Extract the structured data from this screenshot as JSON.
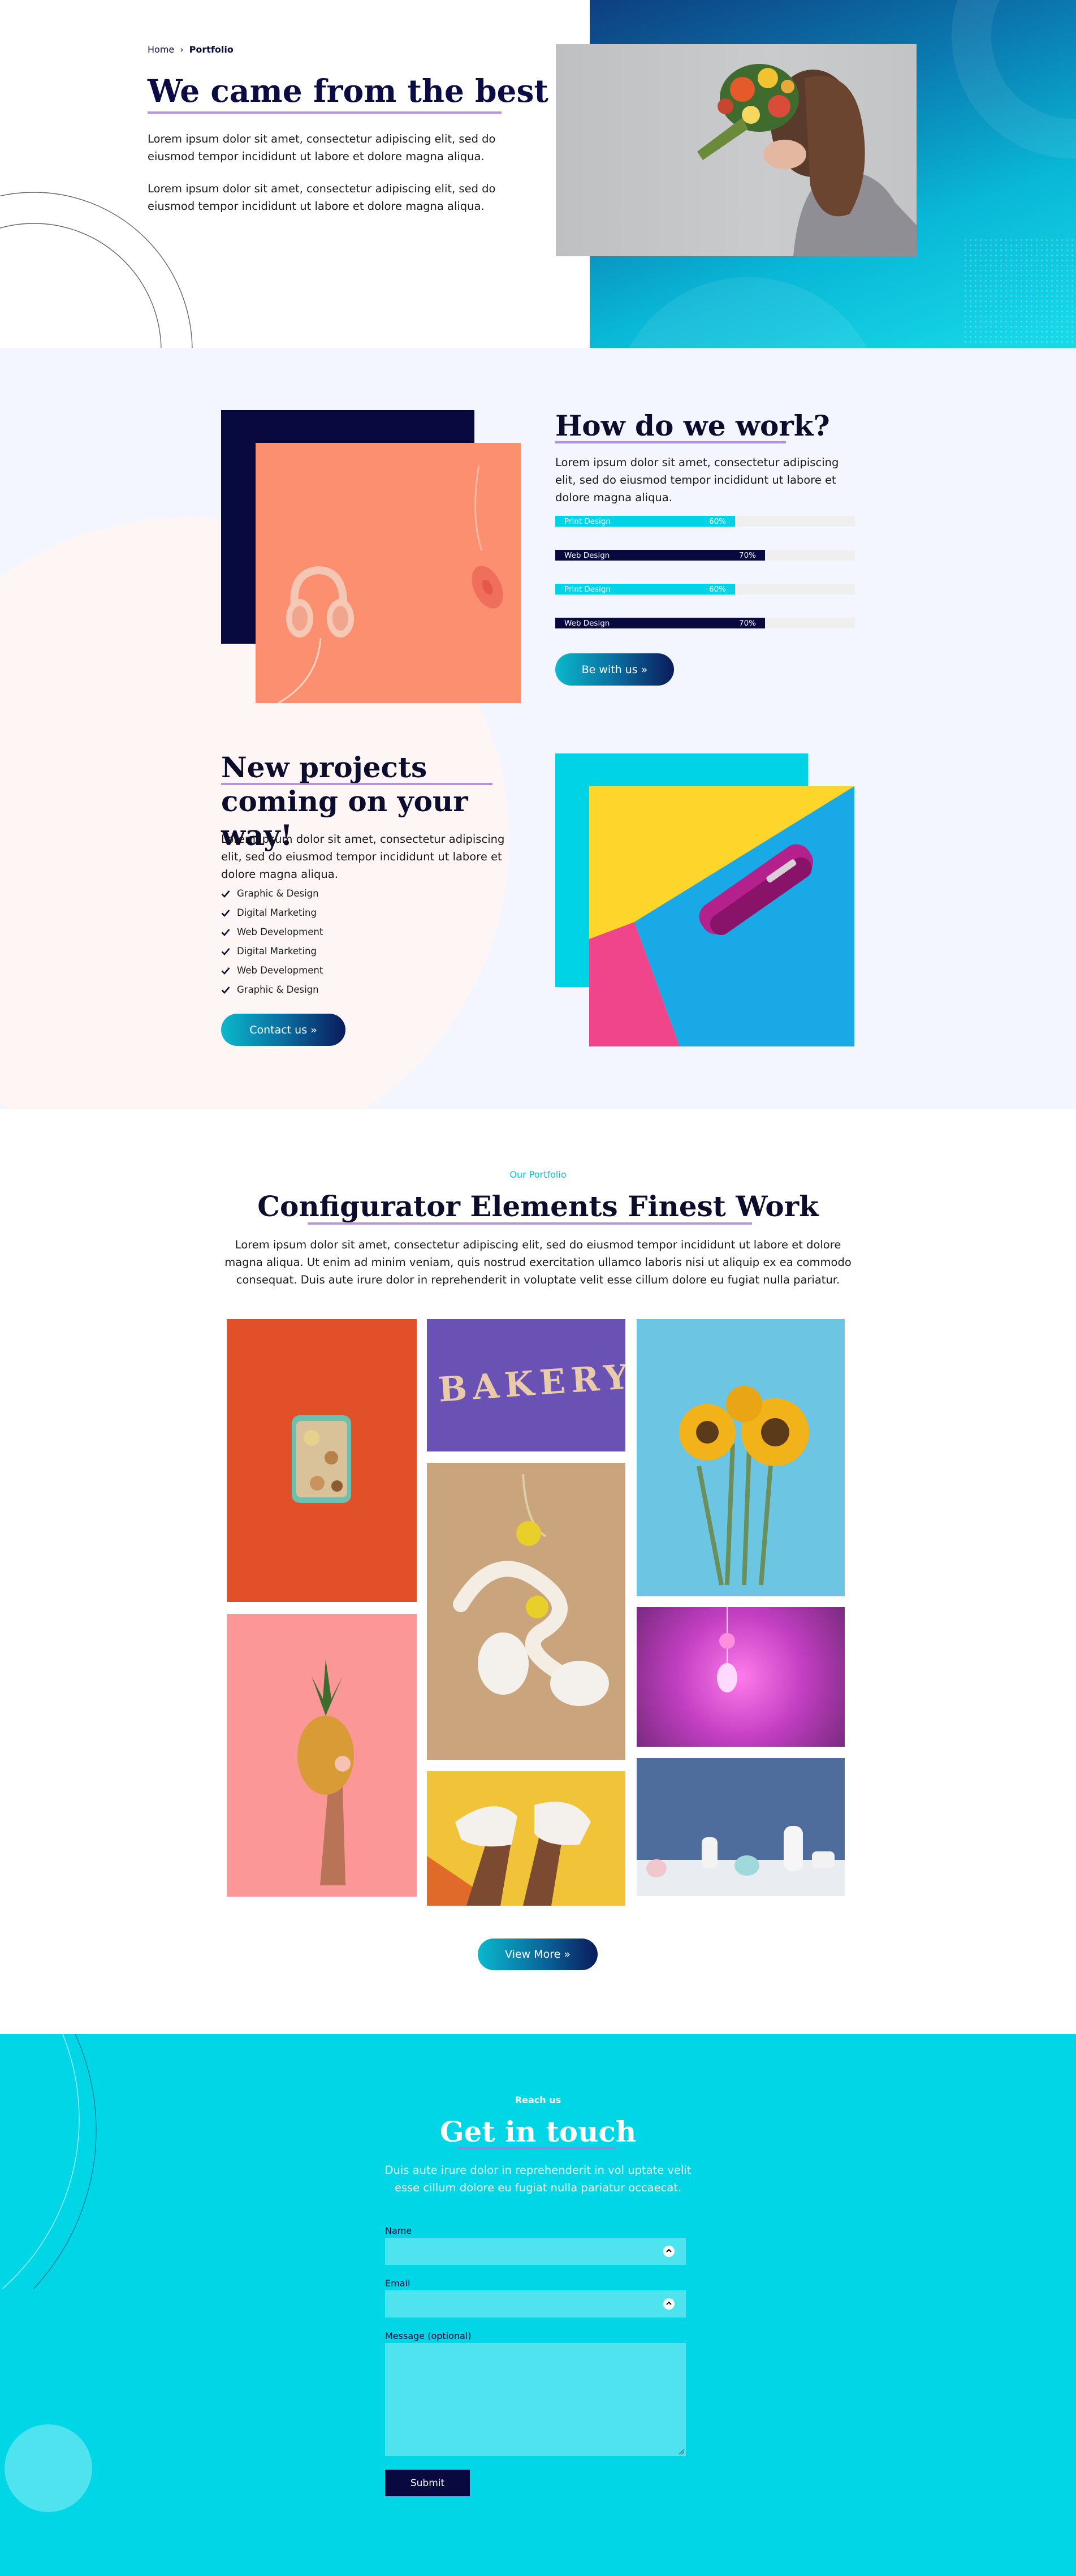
{
  "hero": {
    "breadcrumb": {
      "home": "Home",
      "separator": "›",
      "current": "Portfolio"
    },
    "title": "We came from the best",
    "paragraph1": "Lorem ipsum dolor sit amet, consectetur adipiscing elit, sed do eiusmod tempor incididunt ut labore et dolore magna aliqua.",
    "paragraph2": "Lorem ipsum dolor sit amet, consectetur adipiscing elit, sed do eiusmod tempor incididunt ut labore et dolore magna aliqua."
  },
  "how": {
    "title": "How do we work?",
    "paragraph": "Lorem ipsum dolor sit amet, consectetur adipiscing elit, sed do eiusmod tempor incididunt ut labore et dolore magna aliqua.",
    "bars": [
      {
        "label": "Print Design",
        "percent_text": "60%",
        "value": 60,
        "color": "#00d3e6"
      },
      {
        "label": "Web Design",
        "percent_text": "70%",
        "value": 70,
        "color": "#07093f"
      },
      {
        "label": "Print Design",
        "percent_text": "60%",
        "value": 60,
        "color": "#00d3e6"
      },
      {
        "label": "Web Design",
        "percent_text": "70%",
        "value": 70,
        "color": "#07093f"
      }
    ],
    "button": "Be with us »"
  },
  "projects": {
    "title": "New projects coming on your way!",
    "paragraph": "Lorem ipsum dolor sit amet, consectetur adipiscing elit, sed do eiusmod tempor incididunt ut labore et dolore magna aliqua.",
    "checklist": [
      "Graphic & Design",
      "Digital Marketing",
      "Web Development",
      "Digital Marketing",
      "Web Development",
      "Graphic & Design"
    ],
    "button": "Contact us »"
  },
  "portfolio": {
    "eyebrow": "Our Portfolio",
    "title": "Configurator Elements Finest Work",
    "paragraph": "Lorem ipsum dolor sit amet, consectetur adipiscing elit, sed do eiusmod tempor incididunt ut labore et dolore magna aliqua. Ut enim ad minim veniam, quis nostrud exercitation ullamco laboris nisi ut aliquip ex ea commodo consequat. Duis aute irure dolor in reprehenderit in voluptate velit esse cillum dolore eu fugiat nulla pariatur.",
    "bakery_text": "BAKERY",
    "button": "View More »"
  },
  "contact": {
    "eyebrow": "Reach us",
    "title": "Get in touch",
    "paragraph": "Duis aute irure dolor in reprehenderit in vol uptate velit esse cillum dolore eu fugiat nulla pariatur occaecat.",
    "name_label": "Name",
    "email_label": "Email",
    "message_label": "Message (optional)",
    "submit": "Submit"
  },
  "colors": {
    "navy": "#07093f",
    "cyan": "#00d6e6",
    "lavender_bg": "#f3f5ff",
    "underline": "#a779d8"
  }
}
